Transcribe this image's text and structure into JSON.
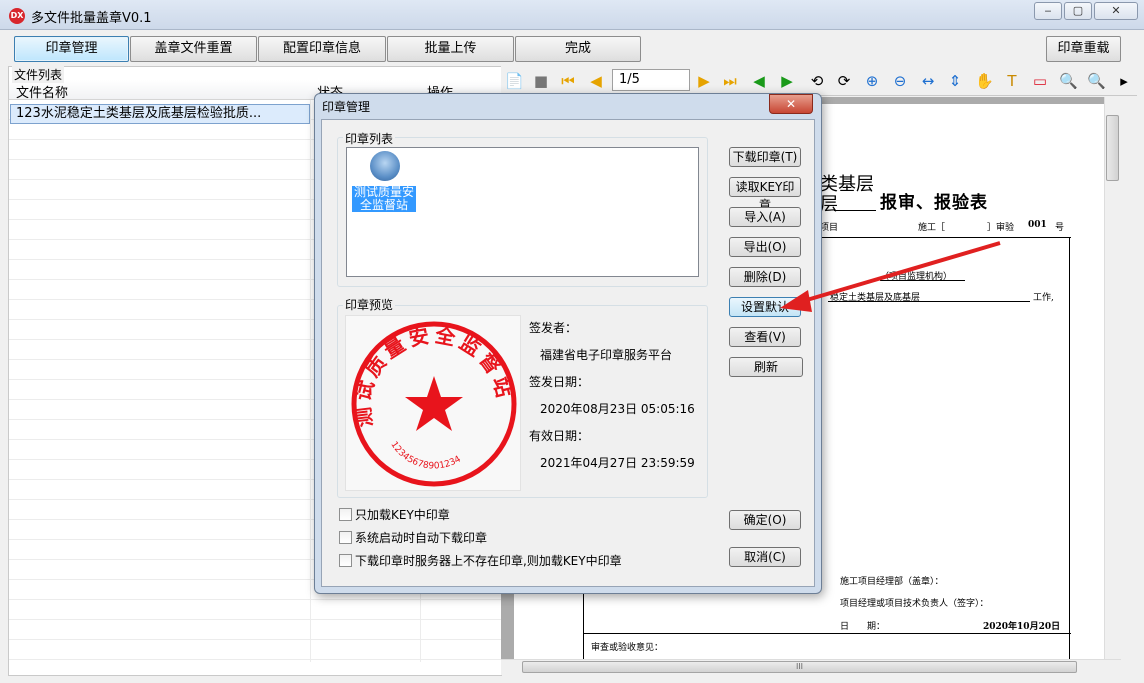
{
  "window": {
    "title": "多文件批量盖章V0.1",
    "app_icon": "DX",
    "minimize": "‒",
    "maximize": "▢",
    "close": "✕"
  },
  "toolbar": {
    "seal_manage": "印章管理",
    "reset_files": "盖章文件重置",
    "config_seal": "配置印章信息",
    "batch_upload": "批量上传",
    "finish": "完成",
    "seal_reload": "印章重载"
  },
  "file_list": {
    "caption": "文件列表",
    "col_name": "文件名称",
    "col_status": "状态",
    "col_action": "操作",
    "rows": [
      {
        "name": "123水泥稳定土类基层及底基层检验批质..."
      }
    ]
  },
  "viewer": {
    "page_indicator": "1/5",
    "scroll_label": "III",
    "doc": {
      "title_line1": "类基层",
      "title_line2_a": "层",
      "title_line2_b": "报审、报验表",
      "line_project": "项目",
      "line_construct": "施工［",
      "line_bracket": "］审验",
      "line_num": "001",
      "line_hao": "号",
      "line_agency": "（项目监理机构）",
      "line_stable": "稳定土类基层及底基层",
      "line_work": "工作,",
      "line_dept": "施工项目经理部（盖章）：",
      "line_manager": "项目经理或项目技术负责人（签字）：",
      "line_date_label": "日　　期：",
      "line_date": "2020年10月20日",
      "line_review": "审查或验收意见："
    }
  },
  "dialog": {
    "title": "印章管理",
    "close": "✕",
    "seal_list_label": "印章列表",
    "seal_item": "测试质量安全监督站",
    "preview_label": "印章预览",
    "seal_text_top": "测试质量安全监督站",
    "seal_serial": "12345678901234",
    "issuer_label": "签发者：",
    "issuer": "福建省电子印章服务平台",
    "issue_date_label": "签发日期：",
    "issue_date": "2020年08月23日 05:05:16",
    "valid_date_label": "有效日期：",
    "valid_date": "2021年04月27日 23:59:59",
    "buttons": {
      "download": "下载印章(T)",
      "read_key": "读取KEY印章",
      "import": "导入(A)",
      "export": "导出(O)",
      "delete": "删除(D)",
      "set_default": "设置默认",
      "view": "查看(V)",
      "refresh": "刷新",
      "ok": "确定(O)",
      "cancel": "取消(C)"
    },
    "checkboxes": [
      "只加载KEY中印章",
      "系统启动时自动下载印章",
      "下载印章时服务器上不存在印章,则加载KEY中印章"
    ]
  },
  "colors": {
    "seal_red": "#e8141c",
    "arrow_red": "#e02020",
    "selection_blue": "#3399ff"
  }
}
